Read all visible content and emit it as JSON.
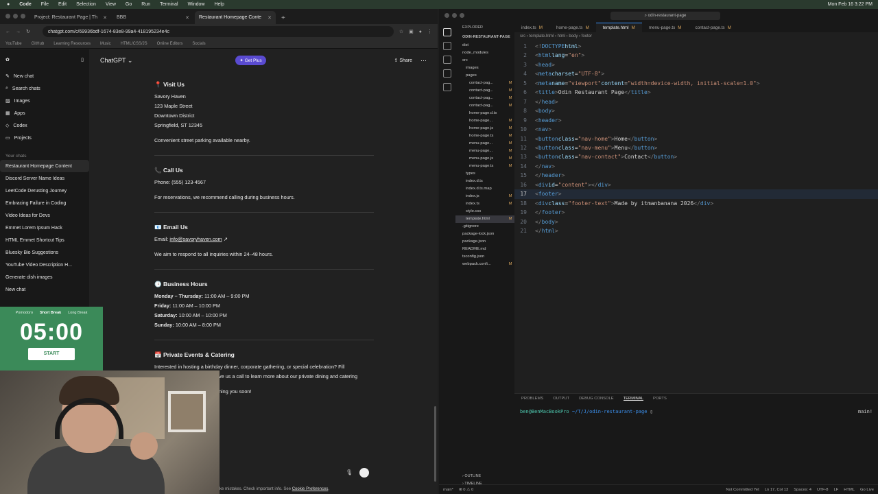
{
  "menubar": {
    "app": "Code",
    "items": [
      "File",
      "Edit",
      "Selection",
      "View",
      "Go",
      "Run",
      "Terminal",
      "Window",
      "Help"
    ],
    "clock": "Mon Feb 16  3:22 PM"
  },
  "browser": {
    "tabs": [
      {
        "label": "Project: Restaurant Page | Th"
      },
      {
        "label": "BBB"
      },
      {
        "label": "Restaurant Homepage Conte"
      }
    ],
    "url": "chatgpt.com/c/69936bdf-1674-83e8-99a4-418195234e4c",
    "bookmarks": [
      "YouTube",
      "GitHub",
      "Learning Resources",
      "Music",
      "HTML/CSS/JS",
      "Online Editors",
      "Socials"
    ]
  },
  "gpt": {
    "model": "ChatGPT",
    "get_plus": "Get Plus",
    "share": "Share",
    "nav": [
      "New chat",
      "Search chats",
      "Images",
      "Apps",
      "Codex",
      "Projects"
    ],
    "chats_label": "Your chats",
    "chats": [
      "Restaurant Homepage Content",
      "Discord Server Name Ideas",
      "LeetCode Derusting Journey",
      "Embracing Failure in Coding",
      "Video Ideas for Devs",
      "Emmet Lorem Ipsum Hack",
      "HTML Emmet Shortcut Tips",
      "Bluesky Bio Suggestions",
      "YouTube Video Description H...",
      "Generate dish images",
      "New chat"
    ],
    "visit": {
      "title": "📍 Visit Us",
      "l1": "Savory Haven",
      "l2": "123 Maple Street",
      "l3": "Downtown District",
      "l4": "Springfield, ST 12345",
      "note": "Convenient street parking available nearby."
    },
    "call": {
      "title": "📞 Call Us",
      "phone": "Phone: (555) 123-4567",
      "note": "For reservations, we recommend calling during business hours."
    },
    "email": {
      "title": "📧 Email Us",
      "label": "Email: ",
      "addr": "info@savoryhaven.com",
      "arrow": "↗",
      "note": "We aim to respond to all inquiries within 24–48 hours."
    },
    "hours": {
      "title": "🕒 Business Hours",
      "rows": [
        {
          "d": "Monday – Thursday:",
          "t": " 11:00 AM – 9:00 PM"
        },
        {
          "d": "Friday:",
          "t": " 11:00 AM – 10:00 PM"
        },
        {
          "d": "Saturday:",
          "t": " 10:00 AM – 10:00 PM"
        },
        {
          "d": "Sunday:",
          "t": " 10:00 AM – 8:00 PM"
        }
      ]
    },
    "events": {
      "title": "📅 Private Events & Catering",
      "l1": "Interested in hosting a birthday dinner, corporate gathering, or special celebration? Fill",
      "l2": "ve us a call to learn more about our private dining and catering",
      "l3": "ning you soon!"
    },
    "footer": {
      "text": "ke mistakes. Check important info. See ",
      "link": "Cookie Preferences",
      "end": "."
    }
  },
  "pomodoro": {
    "modes": [
      "Pomodoro",
      "Short Break",
      "Long Break"
    ],
    "time": "05:00",
    "start": "START"
  },
  "vscode": {
    "search": "odin-restaurant-page",
    "explorer_title": "EXPLORER",
    "root": "ODIN-RESTAURANT-PAGE",
    "files": [
      {
        "n": "dist",
        "m": "",
        "i": 2
      },
      {
        "n": "node_modules",
        "m": "",
        "i": 2
      },
      {
        "n": "src",
        "m": "",
        "i": 2
      },
      {
        "n": "images",
        "m": "",
        "i": 3
      },
      {
        "n": "pages",
        "m": "",
        "i": 3
      },
      {
        "n": "contact-pag...",
        "m": "M",
        "i": 4
      },
      {
        "n": "contact-pag...",
        "m": "M",
        "i": 4
      },
      {
        "n": "contact-pag...",
        "m": "M",
        "i": 4
      },
      {
        "n": "contact-pag...",
        "m": "M",
        "i": 4
      },
      {
        "n": "home-page.d.ts",
        "m": "",
        "i": 4
      },
      {
        "n": "home-page...",
        "m": "M",
        "i": 4
      },
      {
        "n": "home-page.js",
        "m": "M",
        "i": 4
      },
      {
        "n": "home-page.ts",
        "m": "M",
        "i": 4
      },
      {
        "n": "menu-page...",
        "m": "M",
        "i": 4
      },
      {
        "n": "menu-page...",
        "m": "M",
        "i": 4
      },
      {
        "n": "menu-page.js",
        "m": "M",
        "i": 4
      },
      {
        "n": "menu-page.ts",
        "m": "M",
        "i": 4
      },
      {
        "n": "types",
        "m": "",
        "i": 3
      },
      {
        "n": "index.d.ts",
        "m": "",
        "i": 3
      },
      {
        "n": "index.d.ts.map",
        "m": "",
        "i": 3
      },
      {
        "n": "index.js",
        "m": "M",
        "i": 3
      },
      {
        "n": "index.ts",
        "m": "M",
        "i": 3
      },
      {
        "n": "style.css",
        "m": "",
        "i": 3
      },
      {
        "n": "template.html",
        "m": "M",
        "i": 3
      },
      {
        "n": ".gitignore",
        "m": "",
        "i": 2
      },
      {
        "n": "package-lock.json",
        "m": "",
        "i": 2
      },
      {
        "n": "package.json",
        "m": "",
        "i": 2
      },
      {
        "n": "README.md",
        "m": "",
        "i": 2
      },
      {
        "n": "tsconfig.json",
        "m": "",
        "i": 2
      },
      {
        "n": "webpack.confi...",
        "m": "M",
        "i": 2
      }
    ],
    "tabs": [
      {
        "n": "index.ts",
        "m": "M"
      },
      {
        "n": "home-page.ts",
        "m": "M"
      },
      {
        "n": "template.html",
        "m": "M"
      },
      {
        "n": "menu-page.ts",
        "m": "M"
      },
      {
        "n": "contact-page.ts",
        "m": "M"
      }
    ],
    "breadcrumb": "src  ›  template.html  ›  html  ›  body  ›  footer",
    "outline": "OUTLINE",
    "timeline": "TIMELINE",
    "panel_tabs": [
      "PROBLEMS",
      "OUTPUT",
      "DEBUG CONSOLE",
      "TERMINAL",
      "PORTS"
    ],
    "terminal": {
      "user": "ben@BenMacBookPro",
      "path": "~/T/J/odin-restaurant-page",
      "branch": "main!"
    },
    "status": {
      "left": "main*",
      "errs": "⊗ 0 ⚠ 0",
      "commit": "Not Committed Yet",
      "pos": "Ln 17, Col 13",
      "spaces": "Spaces: 4",
      "enc": "UTF-8",
      "eol": "LF",
      "lang": "HTML",
      "live": "Go Live"
    }
  }
}
